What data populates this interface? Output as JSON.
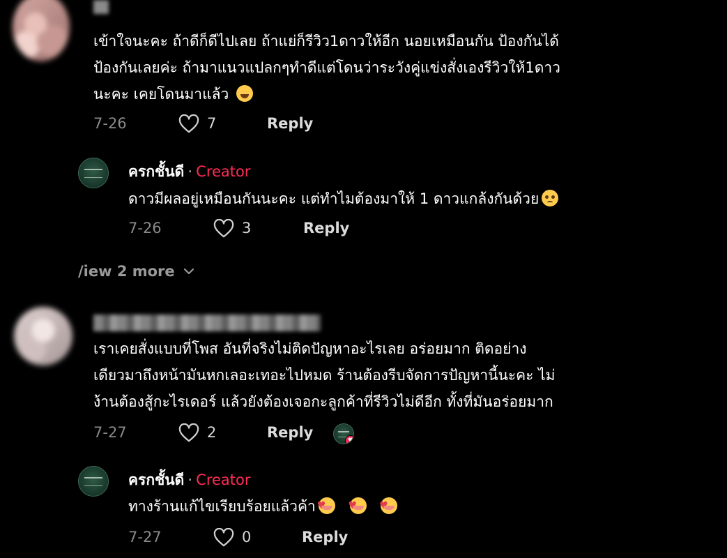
{
  "comments": [
    {
      "lines": [
        "เข้าใจนะคะ ถ้าดีก็ดีไปเลย ถ้าแย่ก็รีวิว1ดาวให้อีก นอยเหมือนกัน ป้องกันได้",
        "ป้องกันเลยค่ะ ถ้ามาแนวแปลกๆทำดีแต่โดนว่าระวังคู่แข่งสั่งเองรีวิวให้1ดาว",
        "นะคะ เคยโดนมาแล้ว"
      ],
      "emoji": "face-with-tears-of-joy",
      "date": "7-26",
      "likes": "7",
      "reply_label": "Reply",
      "reply": {
        "author": "ครกชั้นดี",
        "separator": "·",
        "tag": "Creator",
        "text": "ดาวมีผลอยู่เหมือนกันนะคะ แต่ทำไมต้องมาให้ 1 ดาวแกล้งกันด้วย",
        "emoji": "pleading-face",
        "date": "7-26",
        "likes": "3",
        "reply_label": "Reply"
      },
      "view_more": "/iew 2 more"
    },
    {
      "lines": [
        "เราเคยสั่งแบบที่โพส อันที่จริงไม่ติดปัญหาอะไรเลย อร่อยมาก ติดอย่าง",
        "เดียวมาถึงหน้ามันหกเลอะเทอะไปหมด ร้านต้องรีบจัดการปัญหานี้นะคะ ไม่",
        "ง้านต้องสู้กะไรเดอร์ แล้วยังต้องเจอกะลูกค้าที่รีวิวไม่ดีอีก ทั้งที่มันอร่อยมาก"
      ],
      "date": "7-27",
      "likes": "2",
      "reply_label": "Reply",
      "reply": {
        "author": "ครกชั้นดี",
        "separator": "·",
        "tag": "Creator",
        "text": "ทางร้านแก้ไขเรียบร้อยแล้วค้า",
        "emoji": "smiling-face-with-hearts",
        "date": "7-27",
        "likes": "0",
        "reply_label": "Reply"
      }
    }
  ],
  "colors": {
    "background": "#000000",
    "creator_tag": "#fe2c55",
    "meta_text": "#8a8a8a",
    "creator_avatar": "#1f4433"
  }
}
